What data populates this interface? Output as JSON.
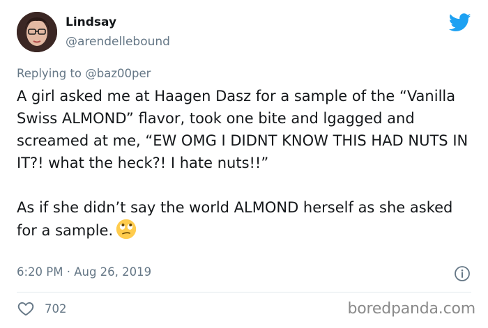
{
  "author": {
    "display_name": "Lindsay",
    "handle": "@arendellebound"
  },
  "reply": {
    "prefix": "Replying to ",
    "mention": "@baz00per"
  },
  "tweet": {
    "paragraph_1": "A girl asked me at Haagen Dasz for a sample of the “Vanilla Swiss ALMOND” flavor, took one bite and lgagged and screamed at me, “EW OMG I DIDNT KNOW THIS HAD NUTS IN IT?! what the heck?! I hate nuts!!”",
    "paragraph_2": "As if she didn’t say the world ALMOND herself as she asked for a sample."
  },
  "meta": {
    "timestamp": "6:20 PM · Aug 26, 2019"
  },
  "actions": {
    "like_count": "702"
  },
  "watermark": "boredpanda.com",
  "icons": {
    "brand": "twitter-bird-icon",
    "info": "info-icon",
    "like": "heart-icon",
    "emoji": "face-with-rolling-eyes-emoji"
  },
  "colors": {
    "twitter_blue": "#1da1f2",
    "text_primary": "#14171a",
    "text_secondary": "#657786",
    "divider": "#e1e8ed"
  }
}
